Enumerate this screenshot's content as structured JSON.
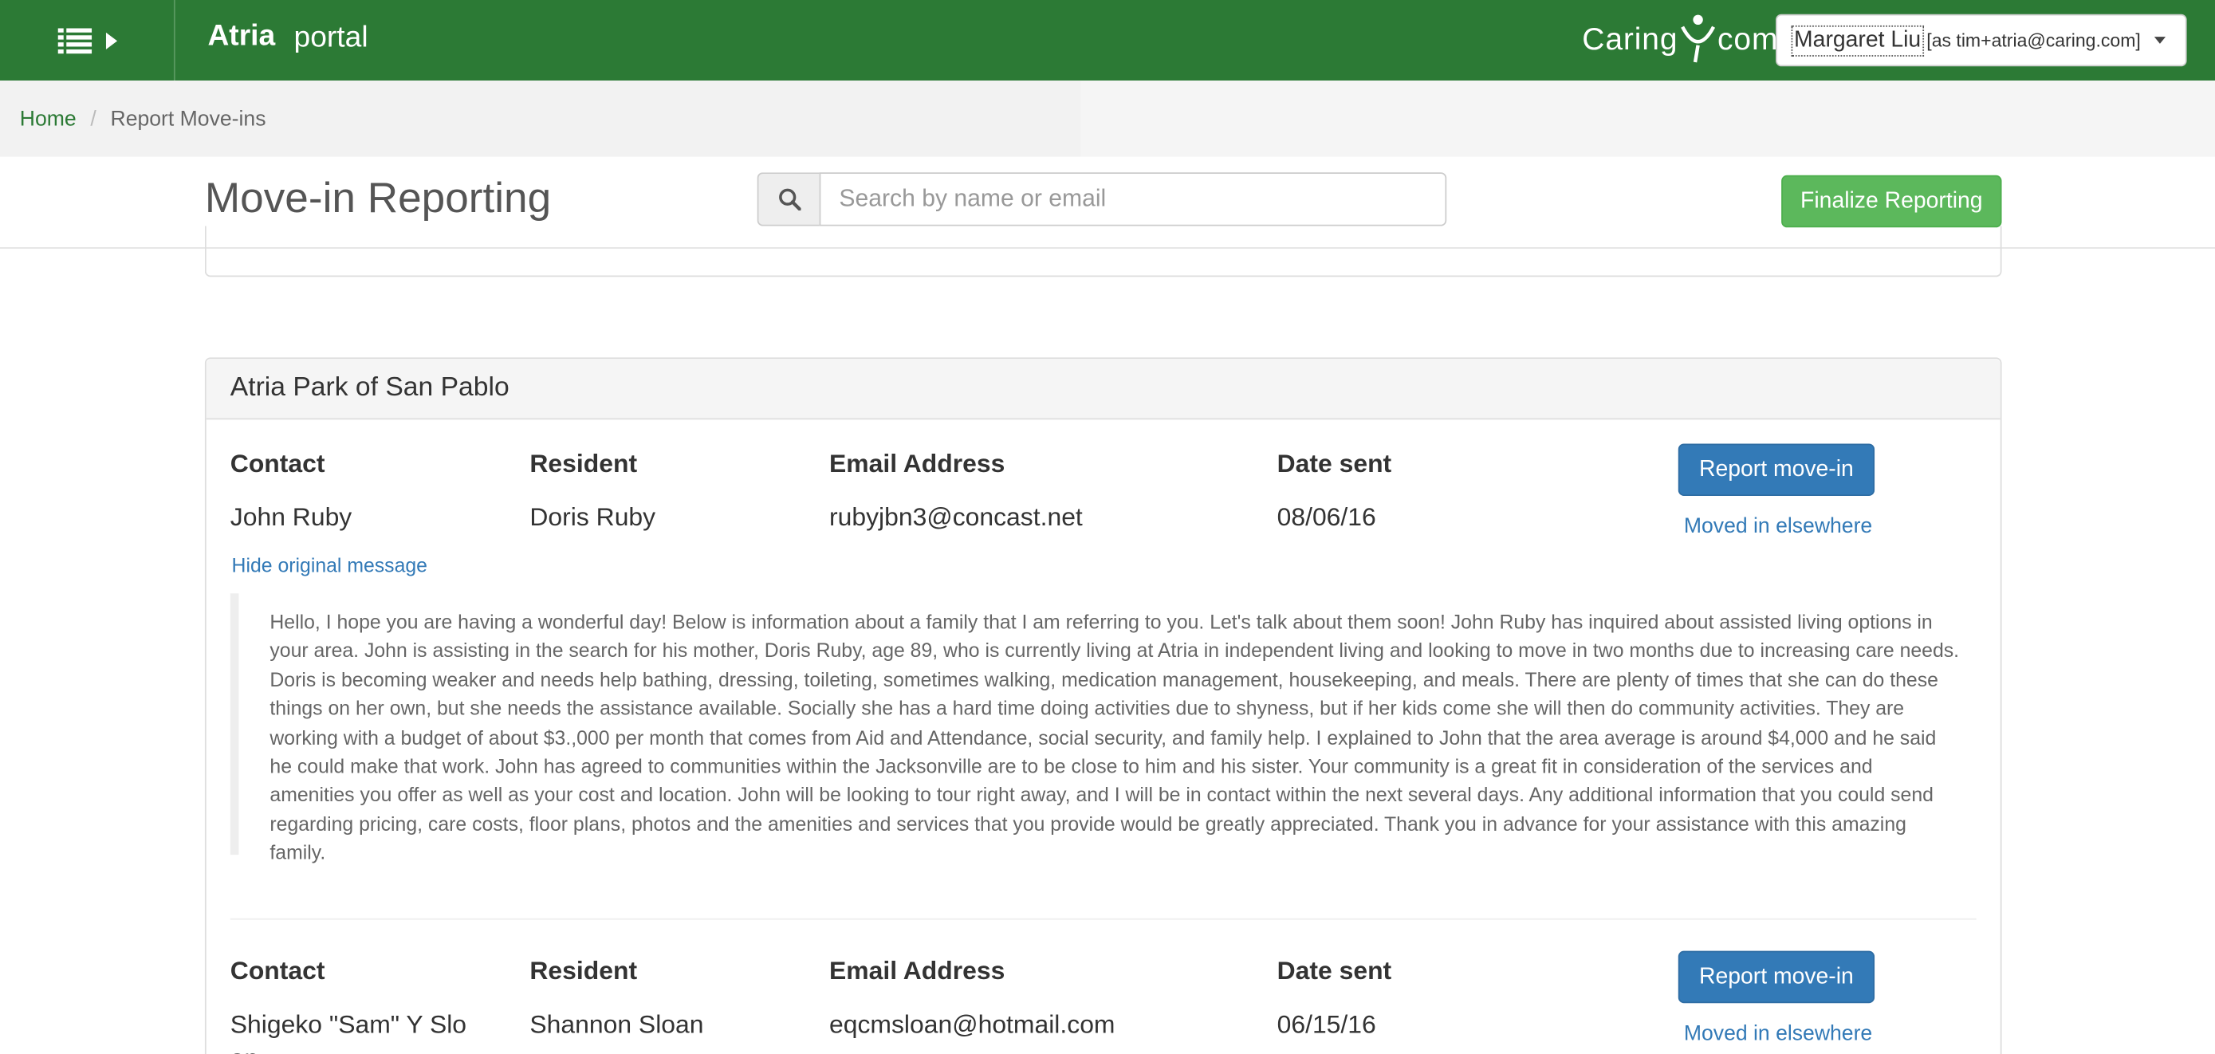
{
  "topbar": {
    "menu_icon": "list-icon",
    "brand": "Atria",
    "brand_sub": "portal",
    "logo": {
      "part1": "Caring",
      "part2": "com"
    },
    "user": {
      "name": "Margaret Liu",
      "as": "[as tim+atria@caring.com]"
    },
    "bg_color": "#2c7a35"
  },
  "breadcrumb": {
    "home": "Home",
    "current": "Report Move-ins"
  },
  "header": {
    "title": "Move-in Reporting",
    "search_placeholder": "Search by name or email",
    "finalize_label": "Finalize Reporting"
  },
  "community": {
    "name": "Atria Park of San Pablo",
    "columns": {
      "contact": "Contact",
      "resident": "Resident",
      "email": "Email Address",
      "date": "Date sent"
    },
    "leads": [
      {
        "contact": "John Ruby",
        "resident": "Doris Ruby",
        "email": "rubyjbn3@concast.net",
        "date": "08/06/16",
        "report_label": "Report move-in",
        "elsewhere_label": "Moved in elsewhere",
        "toggle_label": "Hide original message",
        "message": "Hello, I hope you are having a wonderful day!  Below is information about a family that I am referring to you.  Let's talk about them soon!   John Ruby has inquired about assisted living options in your area.  John is assisting in the search for his mother, Doris Ruby, age 89, who is currently living at Atria in independent living and looking to move in two months due to increasing care needs.  Doris is becoming weaker and needs help bathing, dressing, toileting, sometimes walking, medication management, housekeeping, and meals. There are plenty of times that she can do these things on her own, but she needs the assistance available. Socially she has a hard time doing activities due to shyness, but if her kids come she will then do community activities.  They are working with a budget of about $3.,000 per month that comes from Aid and Attendance, social security, and family help. I explained to John that the area average is around $4,000 and he said he could make that work.  John has agreed to communities within the Jacksonville are to be close to him and his sister.  Your community is a great fit in consideration of the services and amenities you offer as well as your cost and location.  John will be looking to tour right away, and I will be in contact within the next several days.   Any additional information that you could send regarding pricing, care costs, floor plans, photos and the amenities and services that you provide would be greatly appreciated.  Thank you in advance for your assistance with this amazing family."
      },
      {
        "contact": "Shigeko \"Sam\" Y Slo an",
        "resident": "Shannon Sloan",
        "email": "eqcmsloan@hotmail.com",
        "date": "06/15/16",
        "report_label": "Report move-in",
        "elsewhere_label": "Moved in elsewhere"
      }
    ]
  },
  "colors": {
    "primary": "#337ab7",
    "success": "#5cb85c",
    "link_green": "#2c7a35"
  }
}
